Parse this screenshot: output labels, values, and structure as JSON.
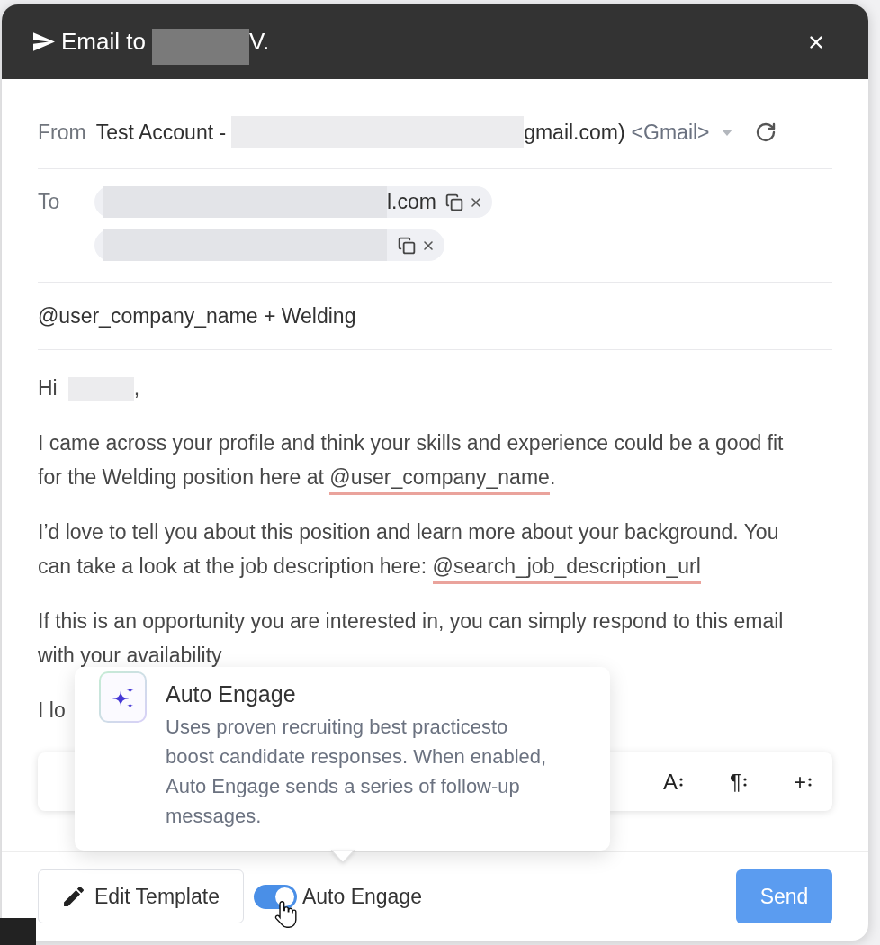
{
  "header": {
    "title": "Email to",
    "title_tail": "V."
  },
  "from": {
    "label": "From",
    "sender_prefix": "Test Account -",
    "sender_suffix": "gmail.com)",
    "provider": "<Gmail>"
  },
  "to": {
    "label": "To",
    "recipients": [
      {
        "kind": "partial",
        "tail": "l.com"
      },
      {
        "kind": "hidden"
      }
    ]
  },
  "subject": "@user_company_name + Welding",
  "body": {
    "greeting": {
      "text": "Hi",
      "punctuation": ","
    },
    "paragraphs": [
      [
        {
          "kind": "plain",
          "text": "I came across your profile and think your skills and experience could be a good fit for the Welding position here at "
        },
        {
          "kind": "mention",
          "text": "@user_company_name"
        },
        {
          "kind": "plain",
          "text": "."
        }
      ],
      [
        {
          "kind": "plain",
          "text": "I’d love to tell you about this position and learn more about your background. You can take a look at the job description here: "
        },
        {
          "kind": "mention",
          "text": "@search_job_description_url"
        }
      ],
      [
        {
          "kind": "plain",
          "text": "If this is an opportunity you are interested in, you can simply respond to this email with your availability"
        }
      ],
      [
        {
          "kind": "plain",
          "text": "I lo"
        }
      ]
    ]
  },
  "toolbar": {
    "buttons": [
      "A",
      "¶",
      "+"
    ]
  },
  "tooltip": {
    "title": "Auto Engage",
    "description": "Uses proven recruiting best practicesto boost candidate responses. When enabled, Auto Engage sends a series of follow-up messages."
  },
  "footer": {
    "edit_button": "Edit Template",
    "auto_engage": {
      "label": "Auto Engage",
      "on": true
    },
    "send_button": "Send"
  }
}
